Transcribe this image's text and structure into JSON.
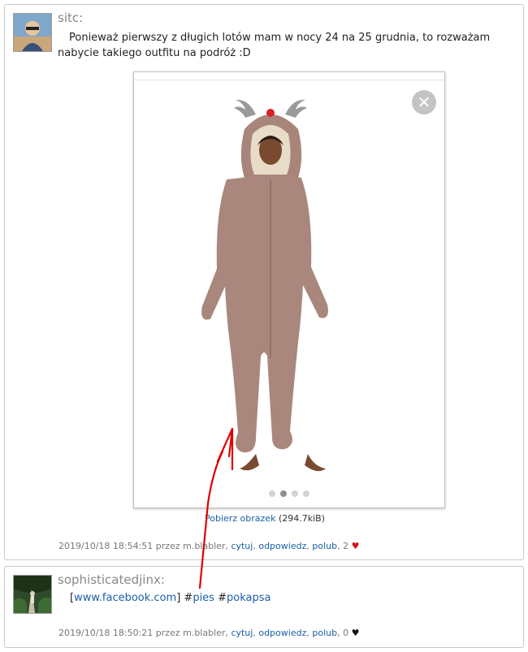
{
  "posts": [
    {
      "author": "sitc:",
      "text": "Ponieważ pierwszy z długich lotów mam w nocy 24 na 25 grudnia, to rozważam nabycie takiego outfitu na podróż :D",
      "gallery": {
        "close_symbol": "✕",
        "dots": [
          {
            "active": false
          },
          {
            "active": true
          },
          {
            "active": false
          },
          {
            "active": false
          }
        ],
        "download_label": "Pobierz obrazek",
        "download_size": "(294.7kiB)"
      },
      "meta": {
        "timestamp": "2019/10/18 18:54:51 przez m.blabler,",
        "actions": [
          "cytuj",
          "odpowiedz",
          "polub"
        ],
        "likes": "2",
        "heart": "♥",
        "heart_color": "#d2141e"
      }
    },
    {
      "author": "sophisticatedjinx:",
      "text_bracket_open": "[",
      "text_link": "www.facebook.com",
      "text_bracket_close": "]",
      "hash1": "#",
      "tag1": "pies",
      "hash2": "#",
      "tag2": "pokapsa",
      "meta": {
        "timestamp": "2019/10/18 18:50:21 przez m.blabler,",
        "actions": [
          "cytuj",
          "odpowiedz",
          "polub"
        ],
        "likes": "0",
        "heart": "♥",
        "heart_color": "#111111"
      }
    }
  ],
  "colors": {
    "link": "#1a5fa8",
    "annotation_arrow": "#e00000"
  },
  "icons": [
    "avatar-image",
    "close-icon",
    "heart-icon",
    "red-arrow-annotation"
  ]
}
